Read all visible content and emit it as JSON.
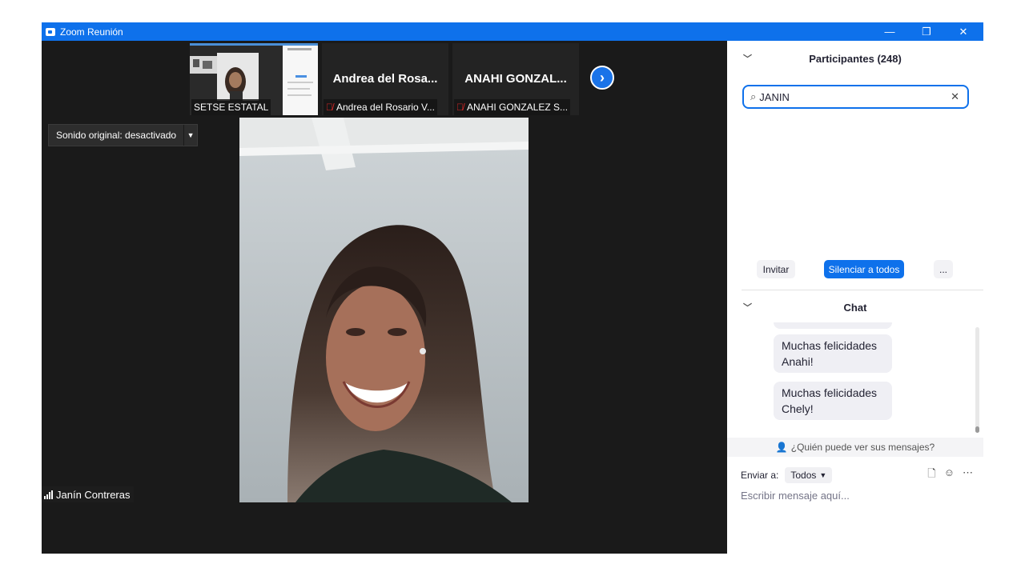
{
  "window": {
    "title": "Zoom Reunión"
  },
  "titlebar_buttons": {
    "minimize": "—",
    "restore": "❐",
    "close": "✕"
  },
  "thumbnails": [
    {
      "label": "SETSE ESTATAL",
      "muted": false
    },
    {
      "display_name": "Andrea del Rosa...",
      "label": "Andrea del Rosario V...",
      "muted": true
    },
    {
      "display_name": "ANAHI GONZAL...",
      "label": "ANAHI GONZALEZ S...",
      "muted": true
    }
  ],
  "sound_button": {
    "label": "Sonido original: desactivado",
    "caret": "▼"
  },
  "speaker": {
    "name": "Janín Contreras"
  },
  "participants": {
    "title": "Participantes (248)",
    "search_value": "JANIN",
    "invite_label": "Invitar",
    "mute_all_label": "Silenciar a todos",
    "more_label": "..."
  },
  "chat": {
    "title": "Chat",
    "messages": [
      "Muchas felicidades Anahi!",
      "Muchas felicidades Chely!"
    ],
    "who_can_see": "¿Quién puede ver sus mensajes?",
    "send_to_label": "Enviar a:",
    "send_to_value": "Todos",
    "input_placeholder": "Escribir mensaje aquí..."
  },
  "colors": {
    "accent": "#0e71eb",
    "muted_mic": "#e02828",
    "video_bg": "#1a1a1a"
  },
  "icons": [
    "zoom-app-icon",
    "next-page-icon",
    "mic-muted-icon",
    "signal-icon",
    "chevron-down-icon",
    "search-icon",
    "clear-icon",
    "person-lock-icon",
    "file-icon",
    "emoji-icon",
    "more-icon"
  ]
}
